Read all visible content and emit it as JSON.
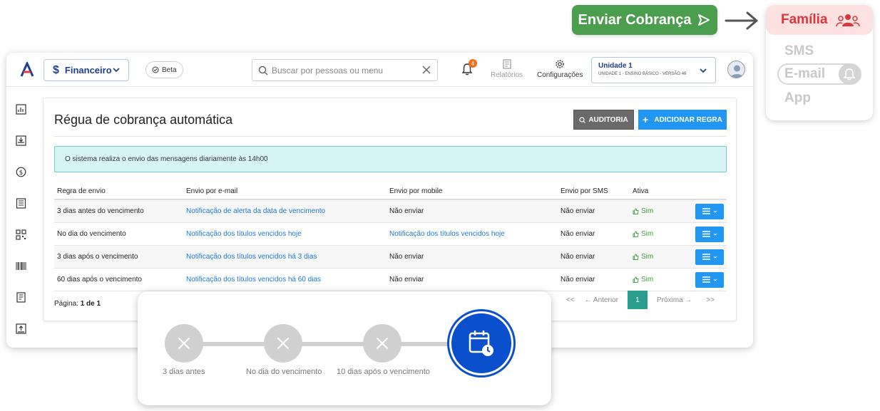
{
  "cta": {
    "label": "Enviar Cobrança"
  },
  "channels": {
    "header": "Família",
    "sms": "SMS",
    "email": "E-mail",
    "app": "App"
  },
  "topbar": {
    "module": "Financeiro",
    "beta": "Beta",
    "search_placeholder": "Buscar por pessoas ou menu",
    "notif_count": "4",
    "reports": "Relatórios",
    "settings": "Configurações",
    "unit_title": "Unidade 1",
    "unit_sub": "UNIDADE 1 - ENSINO BÁSICO - VERSÃO 46"
  },
  "panel": {
    "title": "Régua de cobrança automática",
    "audit_btn": "AUDITORIA",
    "add_btn": "ADICIONAR REGRA",
    "info": "O sistema realiza o envio das mensagens diariamente às 14h00"
  },
  "table": {
    "headers": [
      "Regra de envio",
      "Envio por e-mail",
      "Envio por mobile",
      "Envio por SMS",
      "Ativa"
    ],
    "rows": [
      {
        "rule": "3 dias antes do vencimento",
        "email": "Notificação de alerta da data de vencimento",
        "mobile": "Não enviar",
        "mobile_link": false,
        "sms": "Não enviar",
        "active": "Sim"
      },
      {
        "rule": "No dia do vencimento",
        "email": "Notificação dos títulos vencidos hoje",
        "mobile": "Notificação dos títulos vencidos hoje",
        "mobile_link": true,
        "sms": "Não enviar",
        "active": "Sim"
      },
      {
        "rule": "3 dias após o vencimento",
        "email": "Notificação dos títulos vencidos há 3 dias",
        "mobile": "Não enviar",
        "mobile_link": false,
        "sms": "Não enviar",
        "active": "Sim"
      },
      {
        "rule": "60 dias após o vencimento",
        "email": "Notificação dos títulos vencidos há 60 dias",
        "mobile": "Não enviar",
        "mobile_link": false,
        "sms": "Não enviar",
        "active": "Sim"
      }
    ]
  },
  "pagination": {
    "label_prefix": "Página:",
    "label_value": "1 de 1",
    "first": "<<",
    "prev": "← Anterior",
    "current": "1",
    "next": "Próxima →",
    "last": ">>"
  },
  "timeline": {
    "steps": [
      "3 dias antes",
      "No dia do vencimento",
      "10 dias após o vencimento"
    ]
  },
  "colors": {
    "cta_green": "#4a9e4e",
    "brand_blue": "#1f3f8f",
    "primary_btn": "#2196f3",
    "active_green": "#3aa141",
    "timeline_blue": "#0a4fcb",
    "family_red": "#d9363e"
  }
}
